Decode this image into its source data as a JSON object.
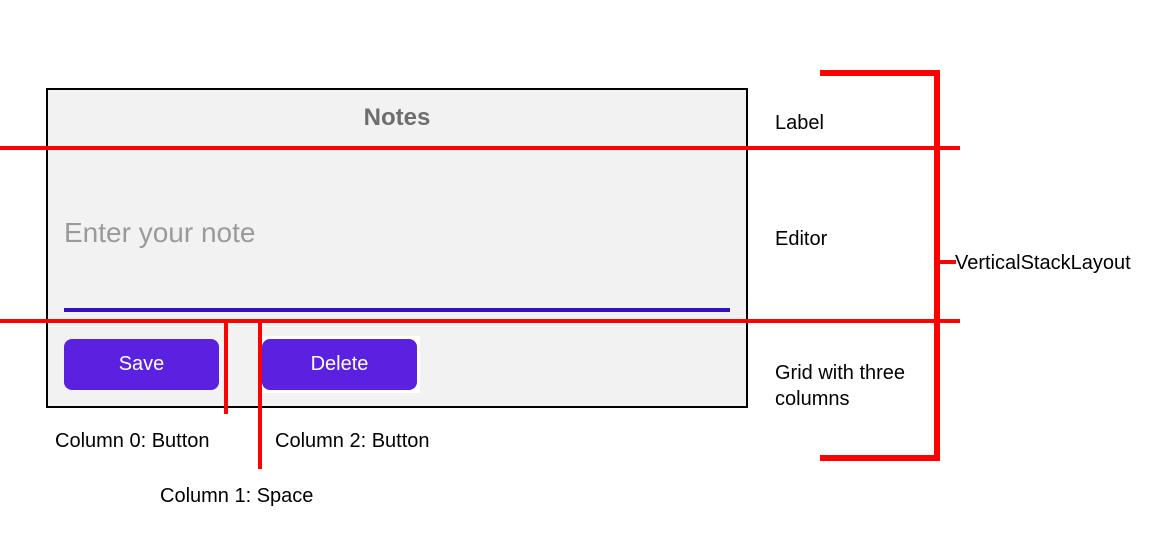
{
  "app": {
    "title": "Notes",
    "editor_placeholder": "Enter your note",
    "buttons": {
      "save": "Save",
      "delete": "Delete"
    }
  },
  "annotations": {
    "label": "Label",
    "editor": "Editor",
    "grid": "Grid with three columns",
    "vstack": "VerticalStackLayout",
    "col0": "Column 0: Button",
    "col1": "Column 1: Space",
    "col2": "Column 2: Button"
  }
}
